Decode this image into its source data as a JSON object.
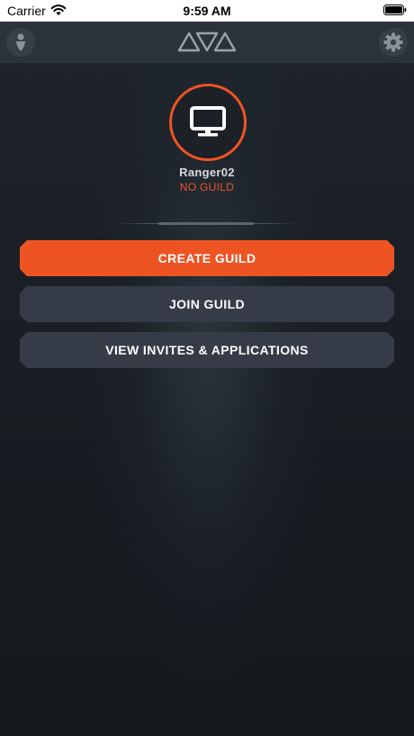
{
  "status_bar": {
    "carrier": "Carrier",
    "time": "9:59 AM"
  },
  "nav": {
    "left_icon": "profile-icon",
    "center_icon": "logo-triangles-icon",
    "right_icon": "gear-icon"
  },
  "profile": {
    "avatar_icon": "monitor-icon",
    "username": "Ranger02",
    "guild_status": "NO GUILD"
  },
  "actions": {
    "create_guild": "CREATE GUILD",
    "join_guild": "JOIN GUILD",
    "view_invites": "VIEW INVITES & APPLICATIONS"
  },
  "colors": {
    "accent": "#ee5423",
    "button_bg": "#353c47",
    "nav_bg": "#2b323b",
    "background": "#171b20"
  }
}
